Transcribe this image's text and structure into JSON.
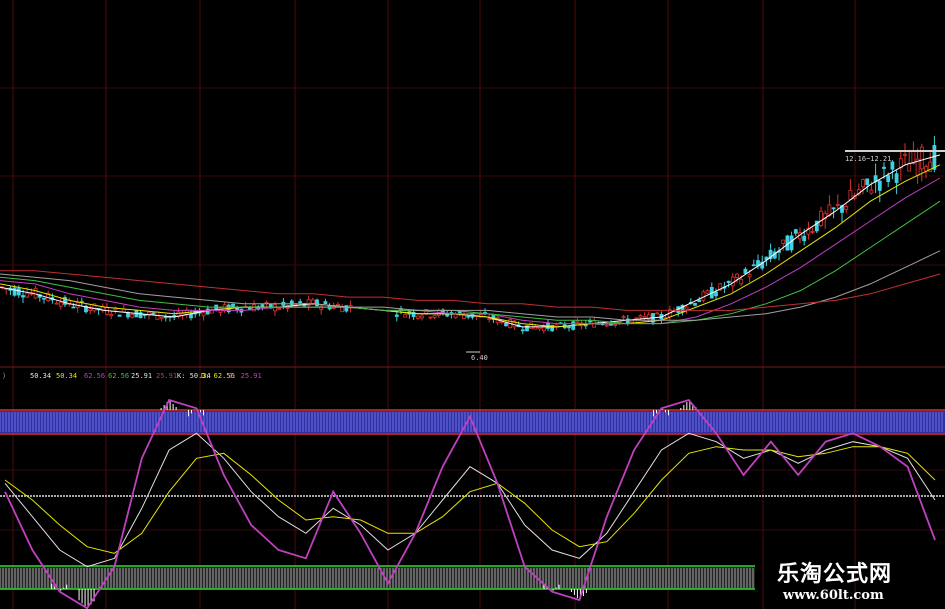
{
  "kdj": {
    "labels": [
      {
        "text": ")",
        "color": "#9a9a9a"
      },
      {
        "text": "50.34",
        "color": "#e0e0e0"
      },
      {
        "text": "50.34",
        "color": "#e6e600"
      },
      {
        "text": "62.56",
        "color": "#c040c0"
      },
      {
        "text": "62.56",
        "color": "#40c040"
      },
      {
        "text": "25.91",
        "color": "#e0e0e0"
      },
      {
        "text": "25.91",
        "color": "#e03030"
      },
      {
        "text": "K: 50.34",
        "color": "#e0e0e0"
      },
      {
        "text": "D: 62.56",
        "color": "#e6e600"
      },
      {
        "text": "J: 25.91",
        "color": "#c040c0"
      }
    ]
  },
  "price": {
    "low_label": "6.40",
    "high_label": "12.16~12.21"
  },
  "watermark": {
    "cn": "乐淘公式网",
    "url": "www.60lt.com"
  },
  "chart_data": [
    {
      "type": "line",
      "title": "",
      "panel": "candlestick price with moving averages",
      "grid": true,
      "annotations": [
        "6.40",
        "12.16~12.21"
      ],
      "series": [
        {
          "color": "#ffffff",
          "values": [
            8.2,
            8.0,
            7.7,
            7.5,
            7.4,
            7.3,
            7.5,
            7.6,
            7.6,
            7.7,
            7.6,
            7.5,
            7.4,
            7.4,
            7.3,
            7.0,
            7.0,
            7.1,
            7.2,
            7.3,
            7.8,
            8.3,
            9.0,
            9.8,
            10.5,
            11.3,
            11.9,
            12.2
          ]
        },
        {
          "color": "#e6e600",
          "values": [
            8.3,
            8.1,
            7.8,
            7.6,
            7.5,
            7.4,
            7.5,
            7.6,
            7.6,
            7.6,
            7.6,
            7.5,
            7.4,
            7.4,
            7.3,
            7.1,
            7.0,
            7.1,
            7.1,
            7.2,
            7.6,
            8.0,
            8.6,
            9.3,
            10.0,
            10.8,
            11.4,
            11.9
          ]
        },
        {
          "color": "#c040c0",
          "values": [
            8.4,
            8.3,
            8.0,
            7.8,
            7.6,
            7.5,
            7.5,
            7.5,
            7.6,
            7.6,
            7.6,
            7.5,
            7.5,
            7.4,
            7.4,
            7.2,
            7.1,
            7.1,
            7.1,
            7.1,
            7.3,
            7.7,
            8.2,
            8.8,
            9.5,
            10.2,
            10.9,
            11.5
          ]
        },
        {
          "color": "#40c040",
          "values": [
            8.5,
            8.4,
            8.2,
            8.0,
            7.8,
            7.7,
            7.6,
            7.6,
            7.6,
            7.6,
            7.6,
            7.5,
            7.5,
            7.5,
            7.4,
            7.3,
            7.2,
            7.2,
            7.1,
            7.1,
            7.2,
            7.4,
            7.7,
            8.1,
            8.7,
            9.4,
            10.1,
            10.8
          ]
        },
        {
          "color": "#a0a0a0",
          "values": [
            8.6,
            8.5,
            8.4,
            8.2,
            8.0,
            7.9,
            7.8,
            7.7,
            7.7,
            7.7,
            7.6,
            7.6,
            7.5,
            7.5,
            7.5,
            7.4,
            7.3,
            7.3,
            7.2,
            7.2,
            7.2,
            7.3,
            7.4,
            7.6,
            7.9,
            8.3,
            8.8,
            9.3
          ]
        },
        {
          "color": "#c03030",
          "values": [
            8.7,
            8.7,
            8.6,
            8.5,
            8.4,
            8.3,
            8.2,
            8.1,
            8.0,
            8.0,
            7.9,
            7.9,
            7.8,
            7.8,
            7.7,
            7.7,
            7.6,
            7.6,
            7.5,
            7.5,
            7.5,
            7.5,
            7.6,
            7.7,
            7.8,
            8.0,
            8.3,
            8.6
          ]
        }
      ]
    },
    {
      "type": "line",
      "title": "",
      "panel": "KDJ indicator",
      "grid": true,
      "ylim": [
        -10,
        110
      ],
      "series": [
        {
          "name": "K",
          "color": "#e0e0e0",
          "values": [
            60,
            40,
            20,
            10,
            15,
            45,
            80,
            90,
            75,
            55,
            40,
            30,
            45,
            35,
            20,
            30,
            50,
            70,
            60,
            35,
            20,
            15,
            30,
            55,
            80,
            90,
            85,
            75,
            80,
            72,
            80,
            85,
            82,
            75,
            50
          ]
        },
        {
          "name": "D",
          "color": "#e6e600",
          "values": [
            62,
            50,
            35,
            22,
            18,
            30,
            55,
            75,
            78,
            65,
            50,
            38,
            40,
            38,
            30,
            30,
            40,
            55,
            60,
            48,
            32,
            22,
            25,
            42,
            62,
            78,
            82,
            80,
            80,
            76,
            78,
            82,
            82,
            78,
            62
          ]
        },
        {
          "name": "J",
          "color": "#c040c0",
          "values": [
            55,
            20,
            -5,
            -15,
            10,
            75,
            110,
            105,
            65,
            35,
            20,
            15,
            55,
            30,
            0,
            30,
            70,
            100,
            60,
            10,
            -5,
            -10,
            40,
            80,
            105,
            110,
            90,
            65,
            85,
            65,
            85,
            90,
            82,
            70,
            26
          ]
        }
      ]
    }
  ]
}
